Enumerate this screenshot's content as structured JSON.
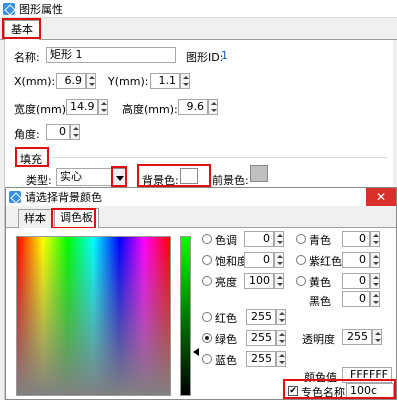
{
  "window": {
    "title": "图形属性"
  },
  "tabs": {
    "basic": "基本"
  },
  "basic": {
    "name_label": "名称:",
    "name_value": "矩形 1",
    "id_label": "图形ID:",
    "id_value": "1",
    "x_label": "X(mm):",
    "x_value": "6.9",
    "y_label": "Y(mm):",
    "y_value": "1.1",
    "width_label": "宽度(mm):",
    "width_value": "14.9",
    "height_label": "高度(mm):",
    "height_value": "9.6",
    "angle_label": "角度:",
    "angle_value": "0"
  },
  "fill": {
    "section_label": "填充",
    "type_label": "类型:",
    "type_value": "实心",
    "bg_label": "背景色:",
    "bg_color": "#ffffff",
    "fg_label": "前景色:",
    "fg_color": "#c0c0c0"
  },
  "dialog": {
    "title": "请选择背景颜色",
    "close": "✕",
    "tab_sample": "样本",
    "tab_palette": "调色板",
    "hue_label": "色调",
    "hue_value": "0",
    "sat_label": "饱和度",
    "sat_value": "0",
    "lum_label": "亮度",
    "lum_value": "100",
    "cyan_label": "青色",
    "cyan_value": "0",
    "magenta_label": "紫红色",
    "magenta_value": "0",
    "yellow_label": "黄色",
    "yellow_value": "0",
    "black_label": "黑色",
    "black_value": "0",
    "red_label": "红色",
    "red_value": "255",
    "green_label": "绿色",
    "green_value": "255",
    "blue_label": "蓝色",
    "blue_value": "255",
    "alpha_label": "透明度",
    "alpha_value": "255",
    "hex_label": "颜色值",
    "hex_value": "FFFFFF",
    "spot_checked": true,
    "spot_label": "专色名称",
    "spot_value": "100c"
  }
}
